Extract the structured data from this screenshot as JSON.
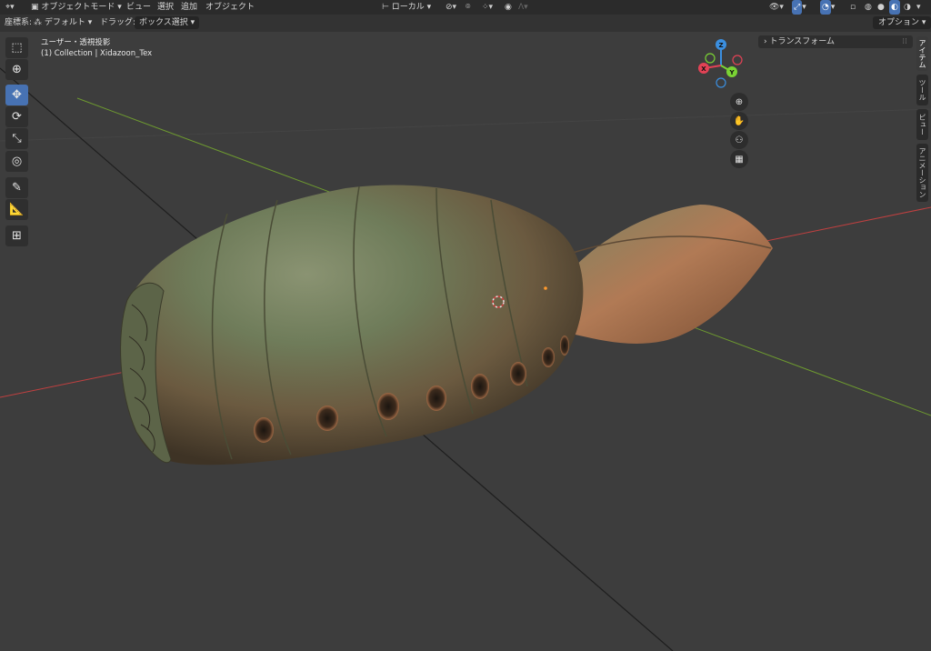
{
  "header": {
    "mode_label": "オブジェクトモード",
    "menus": [
      "ビュー",
      "選択",
      "追加",
      "オブジェクト"
    ],
    "transform_orientation": "ローカル",
    "options_label": "オプション"
  },
  "tool_header": {
    "coord_label": "座標系:",
    "coord_value": "デフォルト",
    "drag_label": "ドラッグ:",
    "drag_value": "ボックス選択"
  },
  "viewport": {
    "view_name": "ユーザー・透視投影",
    "collection_info": "(1) Collection | Xidazoon_Tex"
  },
  "gizmo": {
    "x": "X",
    "y": "Y",
    "z": "Z"
  },
  "sidebar": {
    "panel_title": "トランスフォーム",
    "tabs": [
      "アイテム",
      "ツール",
      "ビュー",
      "アニメーション"
    ]
  },
  "colors": {
    "accent": "#4772b3",
    "axis_x": "#e24255",
    "axis_y": "#7ad334",
    "axis_z": "#3b8fe0",
    "grid_red_line": "#c04040",
    "grid_green_line": "#6e9a30"
  },
  "icons": {
    "toolbar": [
      "select-box-icon",
      "cursor-icon",
      "move-icon",
      "rotate-icon",
      "scale-icon",
      "transform-icon",
      "annotate-icon",
      "measure-icon",
      "add-cube-icon"
    ],
    "nav": [
      "zoom-icon",
      "hand-icon",
      "camera-icon",
      "grid-perspective-icon"
    ]
  }
}
